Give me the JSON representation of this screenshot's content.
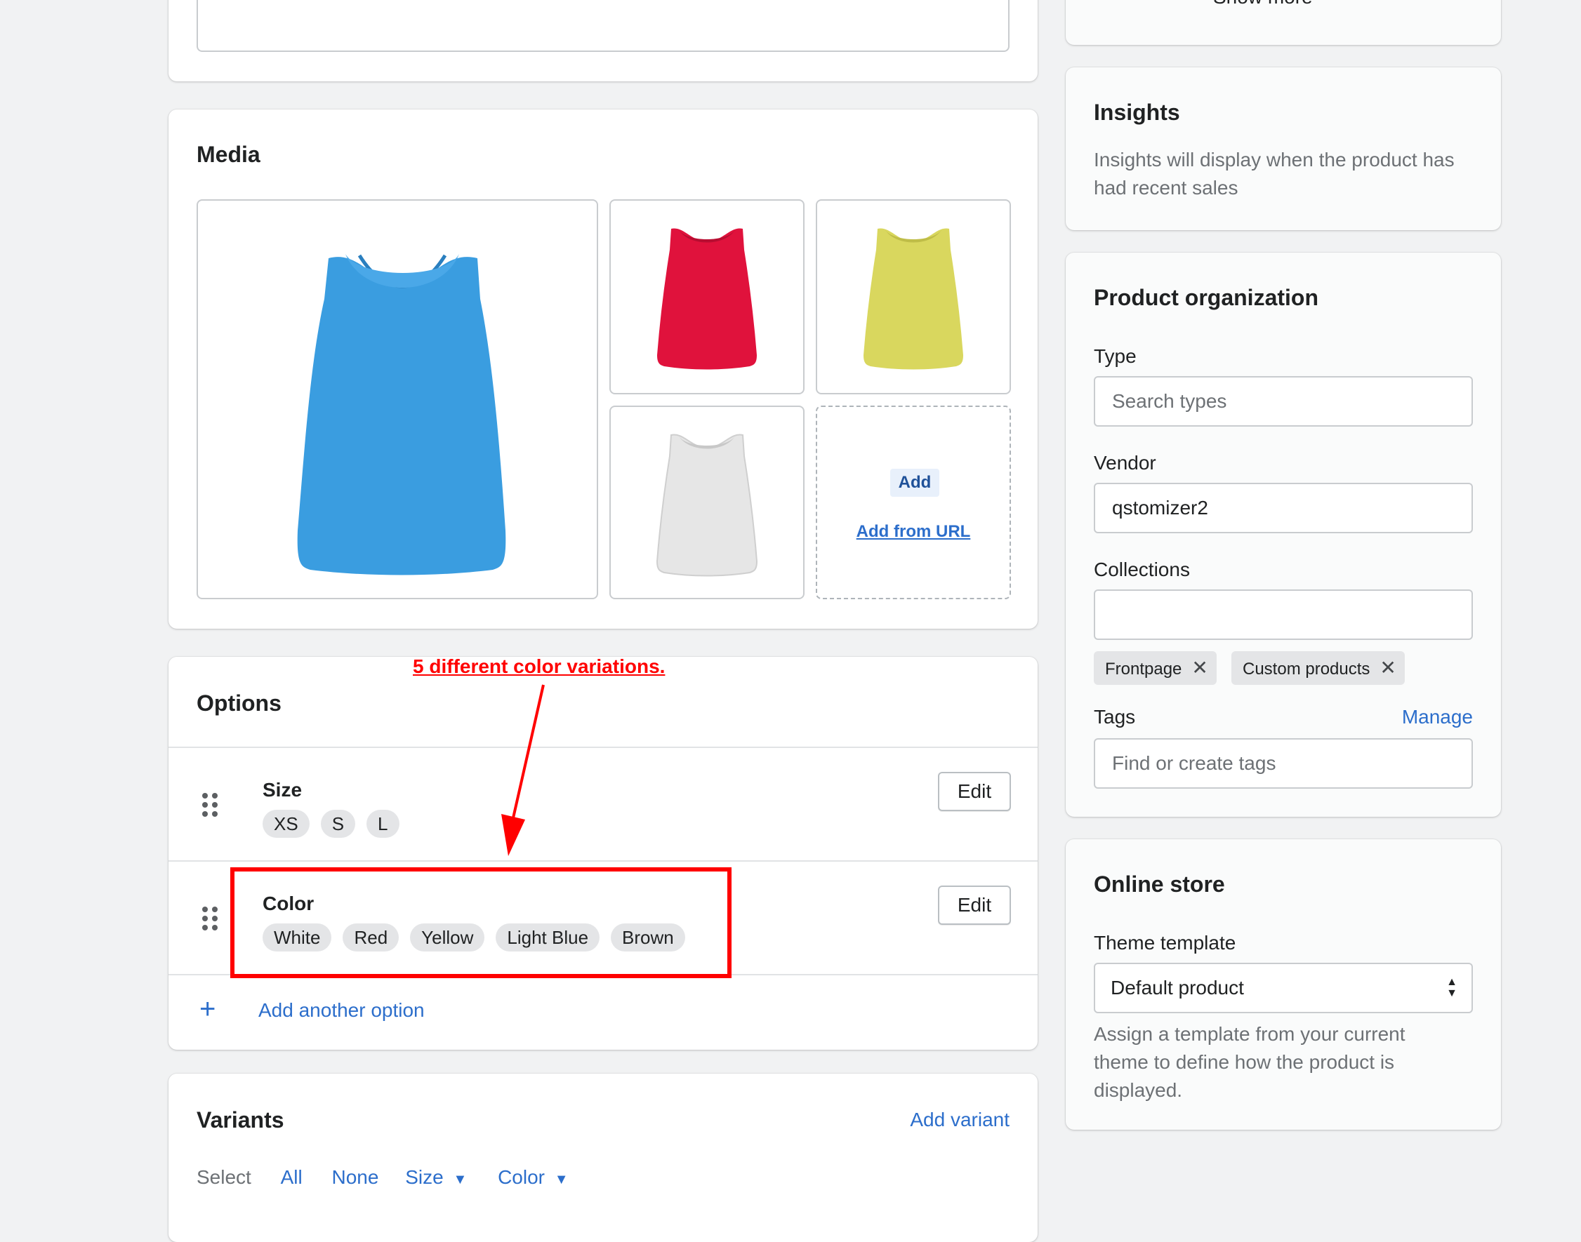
{
  "top_right": {
    "show_more": "Show more"
  },
  "media": {
    "title": "Media",
    "add_label": "Add",
    "add_from_url": "Add from URL"
  },
  "annotation": {
    "text": "5 different color variations.",
    "color": "#ff0000"
  },
  "options": {
    "title": "Options",
    "size": {
      "name": "Size",
      "values": [
        "XS",
        "S",
        "L"
      ],
      "edit": "Edit"
    },
    "color": {
      "name": "Color",
      "values": [
        "White",
        "Red",
        "Yellow",
        "Light Blue",
        "Brown"
      ],
      "edit": "Edit"
    },
    "add_another": "Add another option"
  },
  "variants": {
    "title": "Variants",
    "add_variant": "Add variant",
    "select_label": "Select",
    "all": "All",
    "none": "None",
    "size": "Size",
    "color": "Color"
  },
  "insights": {
    "title": "Insights",
    "text": "Insights will display when the product has had recent sales"
  },
  "organization": {
    "title": "Product organization",
    "type_label": "Type",
    "type_placeholder": "Search types",
    "vendor_label": "Vendor",
    "vendor_value": "qstomizer2",
    "collections_label": "Collections",
    "collections": [
      "Frontpage",
      "Custom products"
    ],
    "tags_label": "Tags",
    "manage": "Manage",
    "tags_placeholder": "Find or create tags"
  },
  "online_store": {
    "title": "Online store",
    "template_label": "Theme template",
    "template_value": "Default product",
    "help": "Assign a template from your current theme to define how the product is displayed."
  },
  "colors": {
    "link": "#2c6ecb",
    "blue_shirt": "#3a9de0",
    "red_shirt": "#e0123c",
    "yellow_shirt": "#d9d75e",
    "white_shirt": "#e6e6e6"
  }
}
